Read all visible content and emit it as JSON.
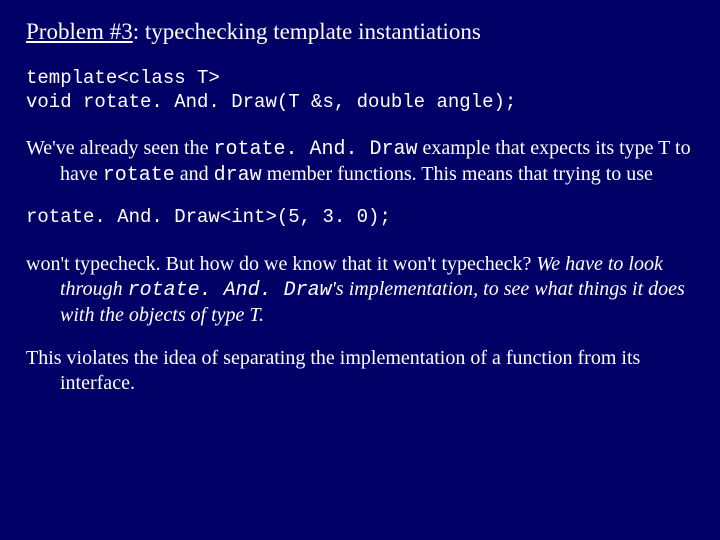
{
  "title_underlined": "Problem #3",
  "title_rest": ": typechecking template instantiations",
  "code_decl_1": "template<class T>",
  "code_decl_2": "void rotate. And. Draw(T &s, double angle);",
  "p1": {
    "a": "We've already seen the ",
    "b_code": "rotate. And. Draw",
    "c": " example that expects its type T to have ",
    "d_code": "rotate",
    "e": " and ",
    "f_code": "draw",
    "g": " member functions.  This means that trying to use"
  },
  "code_call": "rotate. And. Draw<int>(5, 3. 0);",
  "p2": {
    "a": "won't typecheck.  But how do we know that it won't typecheck?  ",
    "b_italic_1": "We have to look through ",
    "c_code_italic": "rotate. And. Draw",
    "d_italic_2": "'s implementation, to see what things it does with the objects of type T."
  },
  "p3": "This violates the idea of separating the implementation of a function from its interface."
}
